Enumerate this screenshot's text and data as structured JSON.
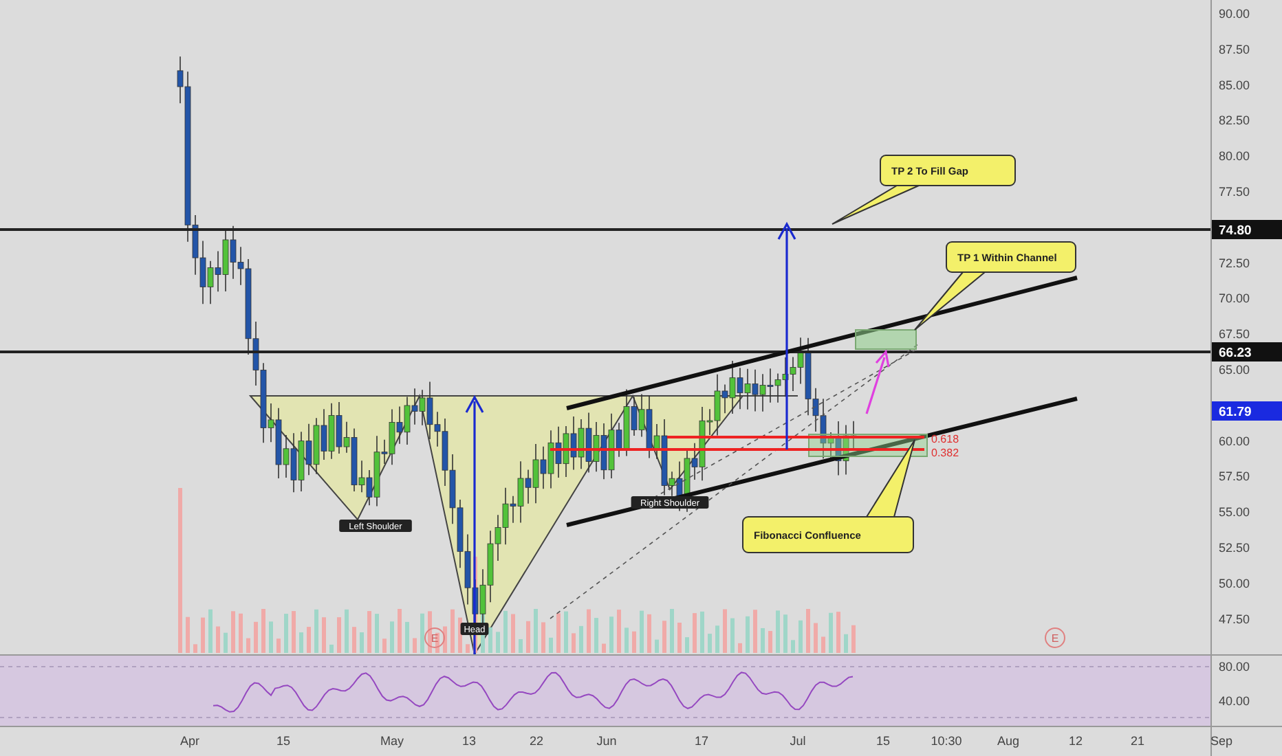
{
  "price_axis": {
    "ticks": [
      "90.00",
      "87.50",
      "85.00",
      "82.50",
      "80.00",
      "77.50",
      "72.50",
      "70.00",
      "67.50",
      "65.00",
      "60.00",
      "57.50",
      "55.00",
      "52.50",
      "50.00",
      "47.50"
    ],
    "markers": [
      {
        "label": "74.80",
        "kind": "line"
      },
      {
        "label": "66.23",
        "kind": "line"
      },
      {
        "label": "61.79",
        "kind": "last"
      }
    ]
  },
  "rsi_axis": {
    "ticks": [
      "80.00",
      "40.00"
    ]
  },
  "time_axis": {
    "labels": [
      "Apr",
      "15",
      "May",
      "13",
      "22",
      "Jun",
      "17",
      "Jul",
      "15",
      "10:30",
      "Aug",
      "12",
      "21",
      "Sep"
    ]
  },
  "pattern_labels": [
    "Left Shoulder",
    "Head",
    "Right Shoulder"
  ],
  "fib_labels": [
    "0.618",
    "0.382"
  ],
  "earnings_markers": [
    "E",
    "E"
  ],
  "callouts": [
    "TP 2 To Fill Gap",
    "TP 1 Within Channel",
    "Fibonacci  Confluence"
  ]
}
